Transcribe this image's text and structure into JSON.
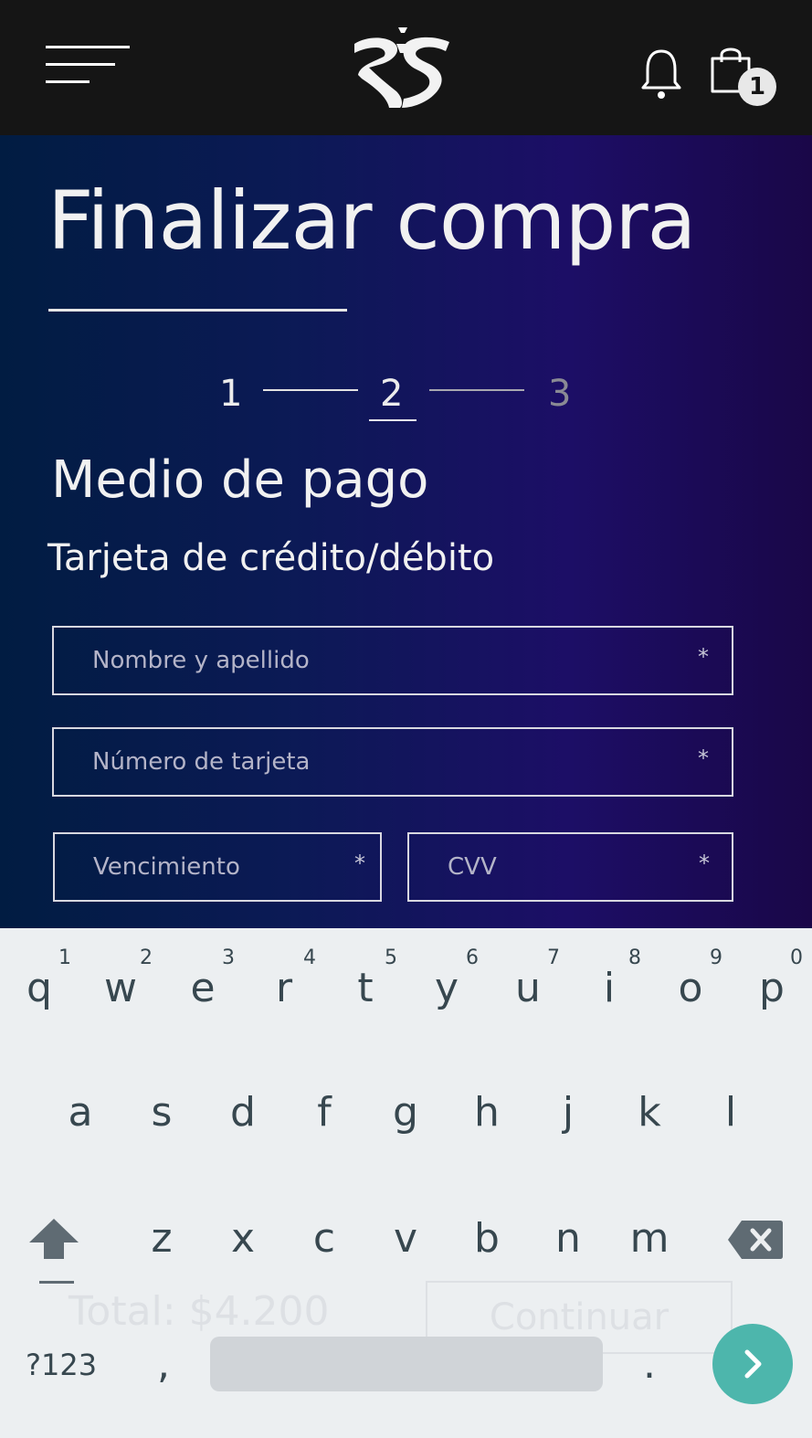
{
  "header": {
    "menu_icon": "hamburger-menu-icon",
    "logo_icon": "brand-logo",
    "bell_icon": "bell-icon",
    "cart_icon": "shopping-bag-icon",
    "cart_count": "1"
  },
  "main": {
    "title": "Finalizar compra",
    "steps": [
      "1",
      "2",
      "3"
    ],
    "active_step": "2",
    "section_title": "Medio de pago",
    "section_subtitle": "Tarjeta de crédito/débito",
    "fields": {
      "name": {
        "placeholder": "Nombre y apellido",
        "required_mark": "*"
      },
      "card_number": {
        "placeholder": "Número de tarjeta",
        "required_mark": "*"
      },
      "expiry": {
        "placeholder": "Vencimiento",
        "required_mark": "*"
      },
      "cvv": {
        "placeholder": "CVV",
        "required_mark": "*"
      }
    }
  },
  "footer": {
    "total": "Total: $4.200",
    "continue_label": "Continuar"
  },
  "keyboard": {
    "row1": [
      "q",
      "w",
      "e",
      "r",
      "t",
      "y",
      "u",
      "i",
      "o",
      "p"
    ],
    "row1_hints": [
      "1",
      "2",
      "3",
      "4",
      "5",
      "6",
      "7",
      "8",
      "9",
      "0"
    ],
    "row2": [
      "a",
      "s",
      "d",
      "f",
      "g",
      "h",
      "j",
      "k",
      "l"
    ],
    "row3": [
      "z",
      "x",
      "c",
      "v",
      "b",
      "n",
      "m"
    ],
    "symbols_label": "?123",
    "comma": ",",
    "period": ".",
    "enter_icon": "chevron-right-icon",
    "shift_icon": "shift-arrow-icon",
    "backspace_icon": "backspace-icon",
    "accent_color": "#4db6ac"
  }
}
